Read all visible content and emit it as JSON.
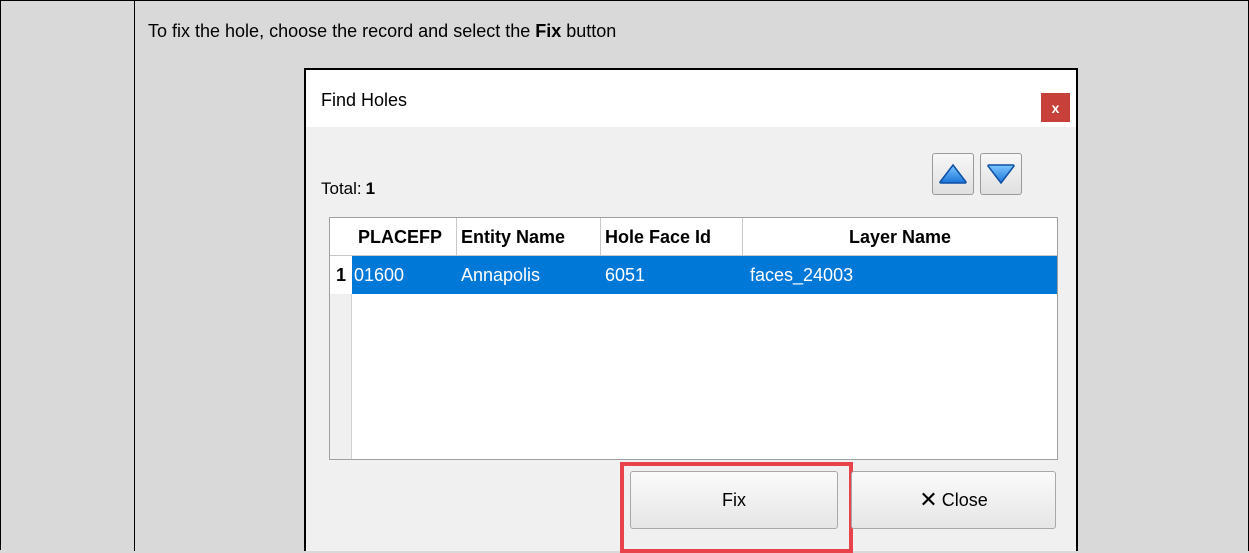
{
  "instruction": {
    "before": "To fix the hole, choose the record and select the ",
    "bold": "Fix",
    "after": " button"
  },
  "dialog": {
    "title": "Find Holes",
    "close_glyph": "x",
    "total_label": "Total:",
    "total_value": "1",
    "columns": [
      "PLACEFP",
      "Entity Name",
      "Hole Face Id",
      "Layer Name"
    ],
    "rows": [
      {
        "index": "1",
        "cells": [
          "01600",
          "Annapolis",
          "6051",
          "faces_24003"
        ]
      }
    ],
    "fix_label": "Fix",
    "close_label": "Close",
    "icons": {
      "up": "arrow-up-icon",
      "down": "arrow-down-icon",
      "close": "close-x-icon"
    },
    "colors": {
      "selection": "#0078d7",
      "highlight": "#e8434a",
      "title_close": "#c8403a"
    }
  }
}
